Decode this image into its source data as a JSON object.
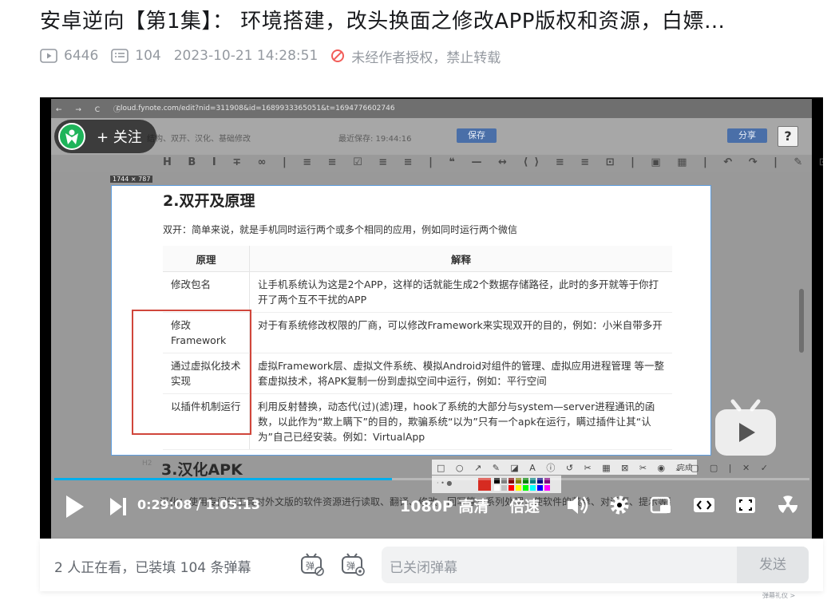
{
  "video": {
    "title": "安卓逆向【第1集】： 环境搭建，改头换面之修改APP版权和资源，白嫖…",
    "views": "6446",
    "danmaku_count": "104",
    "published": "2023-10-21 14:28:51",
    "copyright_notice": "未经作者授权，禁止转载"
  },
  "browser": {
    "url": "cloud.fynote.com/edit?nid=311908&id=1689933365051&t=1694776602746",
    "breadcrumb": "结构、双开、汉化、基础修改",
    "save_status": "最近保存: 19:44:16",
    "save_button": "保存",
    "share_button": "分享",
    "help_button": "?",
    "dim_label": "1744 × 787",
    "h2_tag": "H2"
  },
  "doc": {
    "heading": "2.双开及原理",
    "intro": "双开：简单来说，就是手机同时运行两个或多个相同的应用，例如同时运行两个微信",
    "table_headers": [
      "原理",
      "解释"
    ],
    "rows": [
      {
        "principle": "修改包名",
        "explain": "让手机系统认为这是2个APP，这样的话就能生成2个数据存储路径，此时的多开就等于你打开了两个互不干扰的APP"
      },
      {
        "principle": "修改Framework",
        "explain": "对于有系统修改权限的厂商，可以修改Framework来实现双开的目的，例如：小米自带多开"
      },
      {
        "principle": "通过虚拟化技术实现",
        "explain": "虚拟Framework层、虚拟文件系统、模拟Android对组件的管理、虚拟应用进程管理 等一整套虚拟技术，将APK复制一份到虚拟空间中运行，例如：平行空间"
      },
      {
        "principle": "以插件机制运行",
        "explain": "利用反射替换，动态代(过)(滤)理，hook了系统的大部分与system—server进程通讯的函数，以此作为“欺上瞒下”的目的，欺骗系统“以为”只有一个apk在运行，瞒过插件让其“认为”自己已经安装。例如：VirtualApp"
      }
    ],
    "next_heading": "3.汉化APK",
    "next_text": "汉化：使用专门的工具对外文版的软件资源进行读取、翻译、修改、回写等一系列处理，使软件的菜单、对话框、提示等用户界面显示为中文，而程序的内核和功能保持不变，这个过程即为软件汉化",
    "annotation_finish": "完成"
  },
  "player": {
    "follow_label": "+ 关注",
    "current_time": "0:29:08",
    "total_time": "1:05:13",
    "time_sep": " / ",
    "quality": "1080P 高清",
    "speed": "倍速",
    "progress": 0.447
  },
  "danmaku": {
    "watching": "2 人正在看，已装填 104 条弹幕",
    "input_placeholder": "已关闭弹幕",
    "send_label": "发送",
    "corner_text": "弹幕礼仪 >"
  },
  "colors": {
    "accent": "#00aeec",
    "red_box": "#d0463b",
    "palette": [
      "#000000",
      "#808080",
      "#800000",
      "#808000",
      "#008000",
      "#008080",
      "#000080",
      "#800080",
      "#ffffff",
      "#c0c0c0",
      "#ff0000",
      "#ffff00",
      "#00ff00",
      "#00ffff",
      "#0000ff",
      "#ff00ff"
    ]
  }
}
